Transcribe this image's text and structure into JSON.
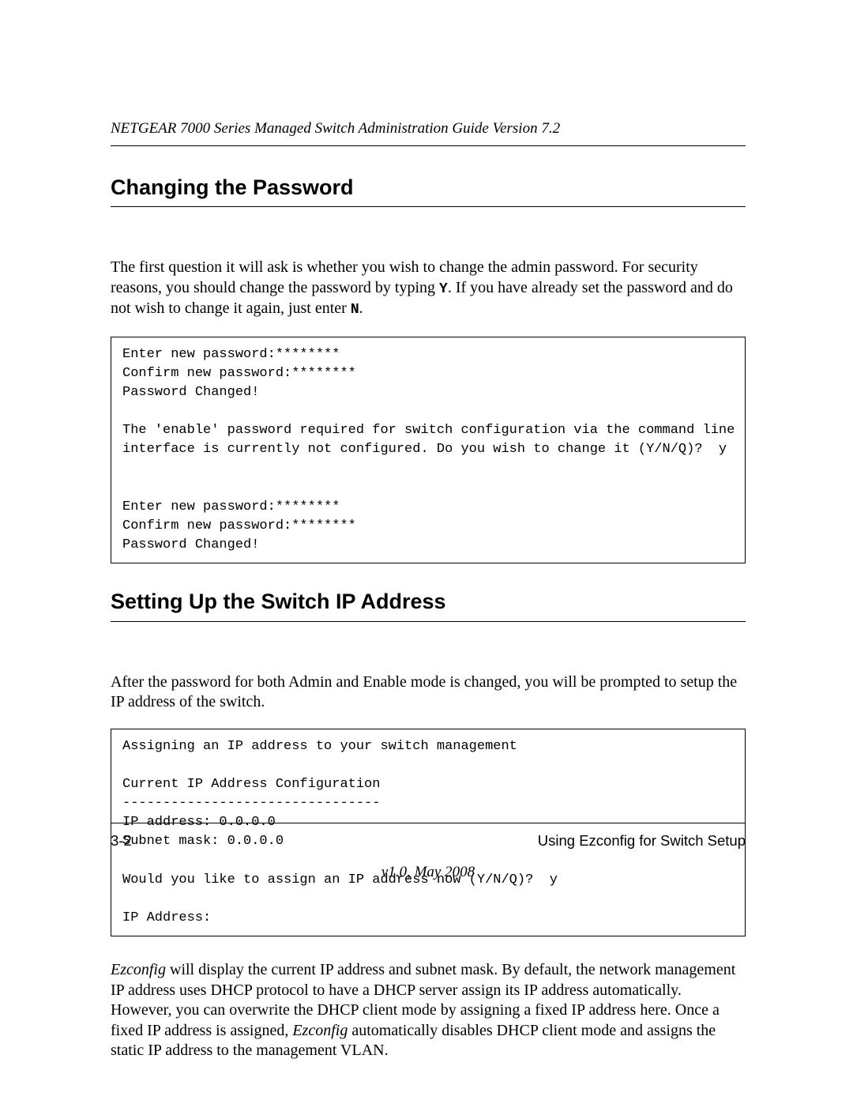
{
  "header": {
    "running": "NETGEAR 7000 Series Managed Switch Administration Guide Version 7.2"
  },
  "section1": {
    "title": "Changing the Password",
    "para_pre": "The first question it will ask is whether you wish to change the admin password. For security reasons, you should change the password by typing ",
    "yes_key": "Y",
    "para_mid": ". If you have already set the password and do not wish to change it again, just enter ",
    "no_key": "N",
    "para_post": ".",
    "code": "Enter new password:********\nConfirm new password:********\nPassword Changed!\n\nThe 'enable' password required for switch configuration via the command line \ninterface is currently not configured. Do you wish to change it (Y/N/Q)?  y\n\n\nEnter new password:********\nConfirm new password:********\nPassword Changed!"
  },
  "section2": {
    "title": "Setting Up the Switch IP Address",
    "para": "After the password for both Admin and Enable mode is changed, you will be prompted to setup the IP address of the switch.",
    "code": "Assigning an IP address to your switch management\n\nCurrent IP Address Configuration\n--------------------------------\nIP address: 0.0.0.0\nSubnet mask: 0.0.0.0\n\nWould you like to assign an IP address now (Y/N/Q)?  y\n\nIP Address:",
    "para2_a": "Ezconfig",
    "para2_b": " will display the current IP address and subnet mask. By default, the network management IP address uses DHCP protocol to have a DHCP server assign its IP address automatically. However, you can overwrite the DHCP client mode by assigning a fixed IP address here. Once a fixed IP address is assigned, ",
    "para2_c": "Ezconfig",
    "para2_d": " automatically disables DHCP client mode and assigns the static IP address to the management VLAN."
  },
  "footer": {
    "page": "3-2",
    "section": "Using Ezconfig for Switch Setup",
    "version": "v1.0, May 2008"
  }
}
